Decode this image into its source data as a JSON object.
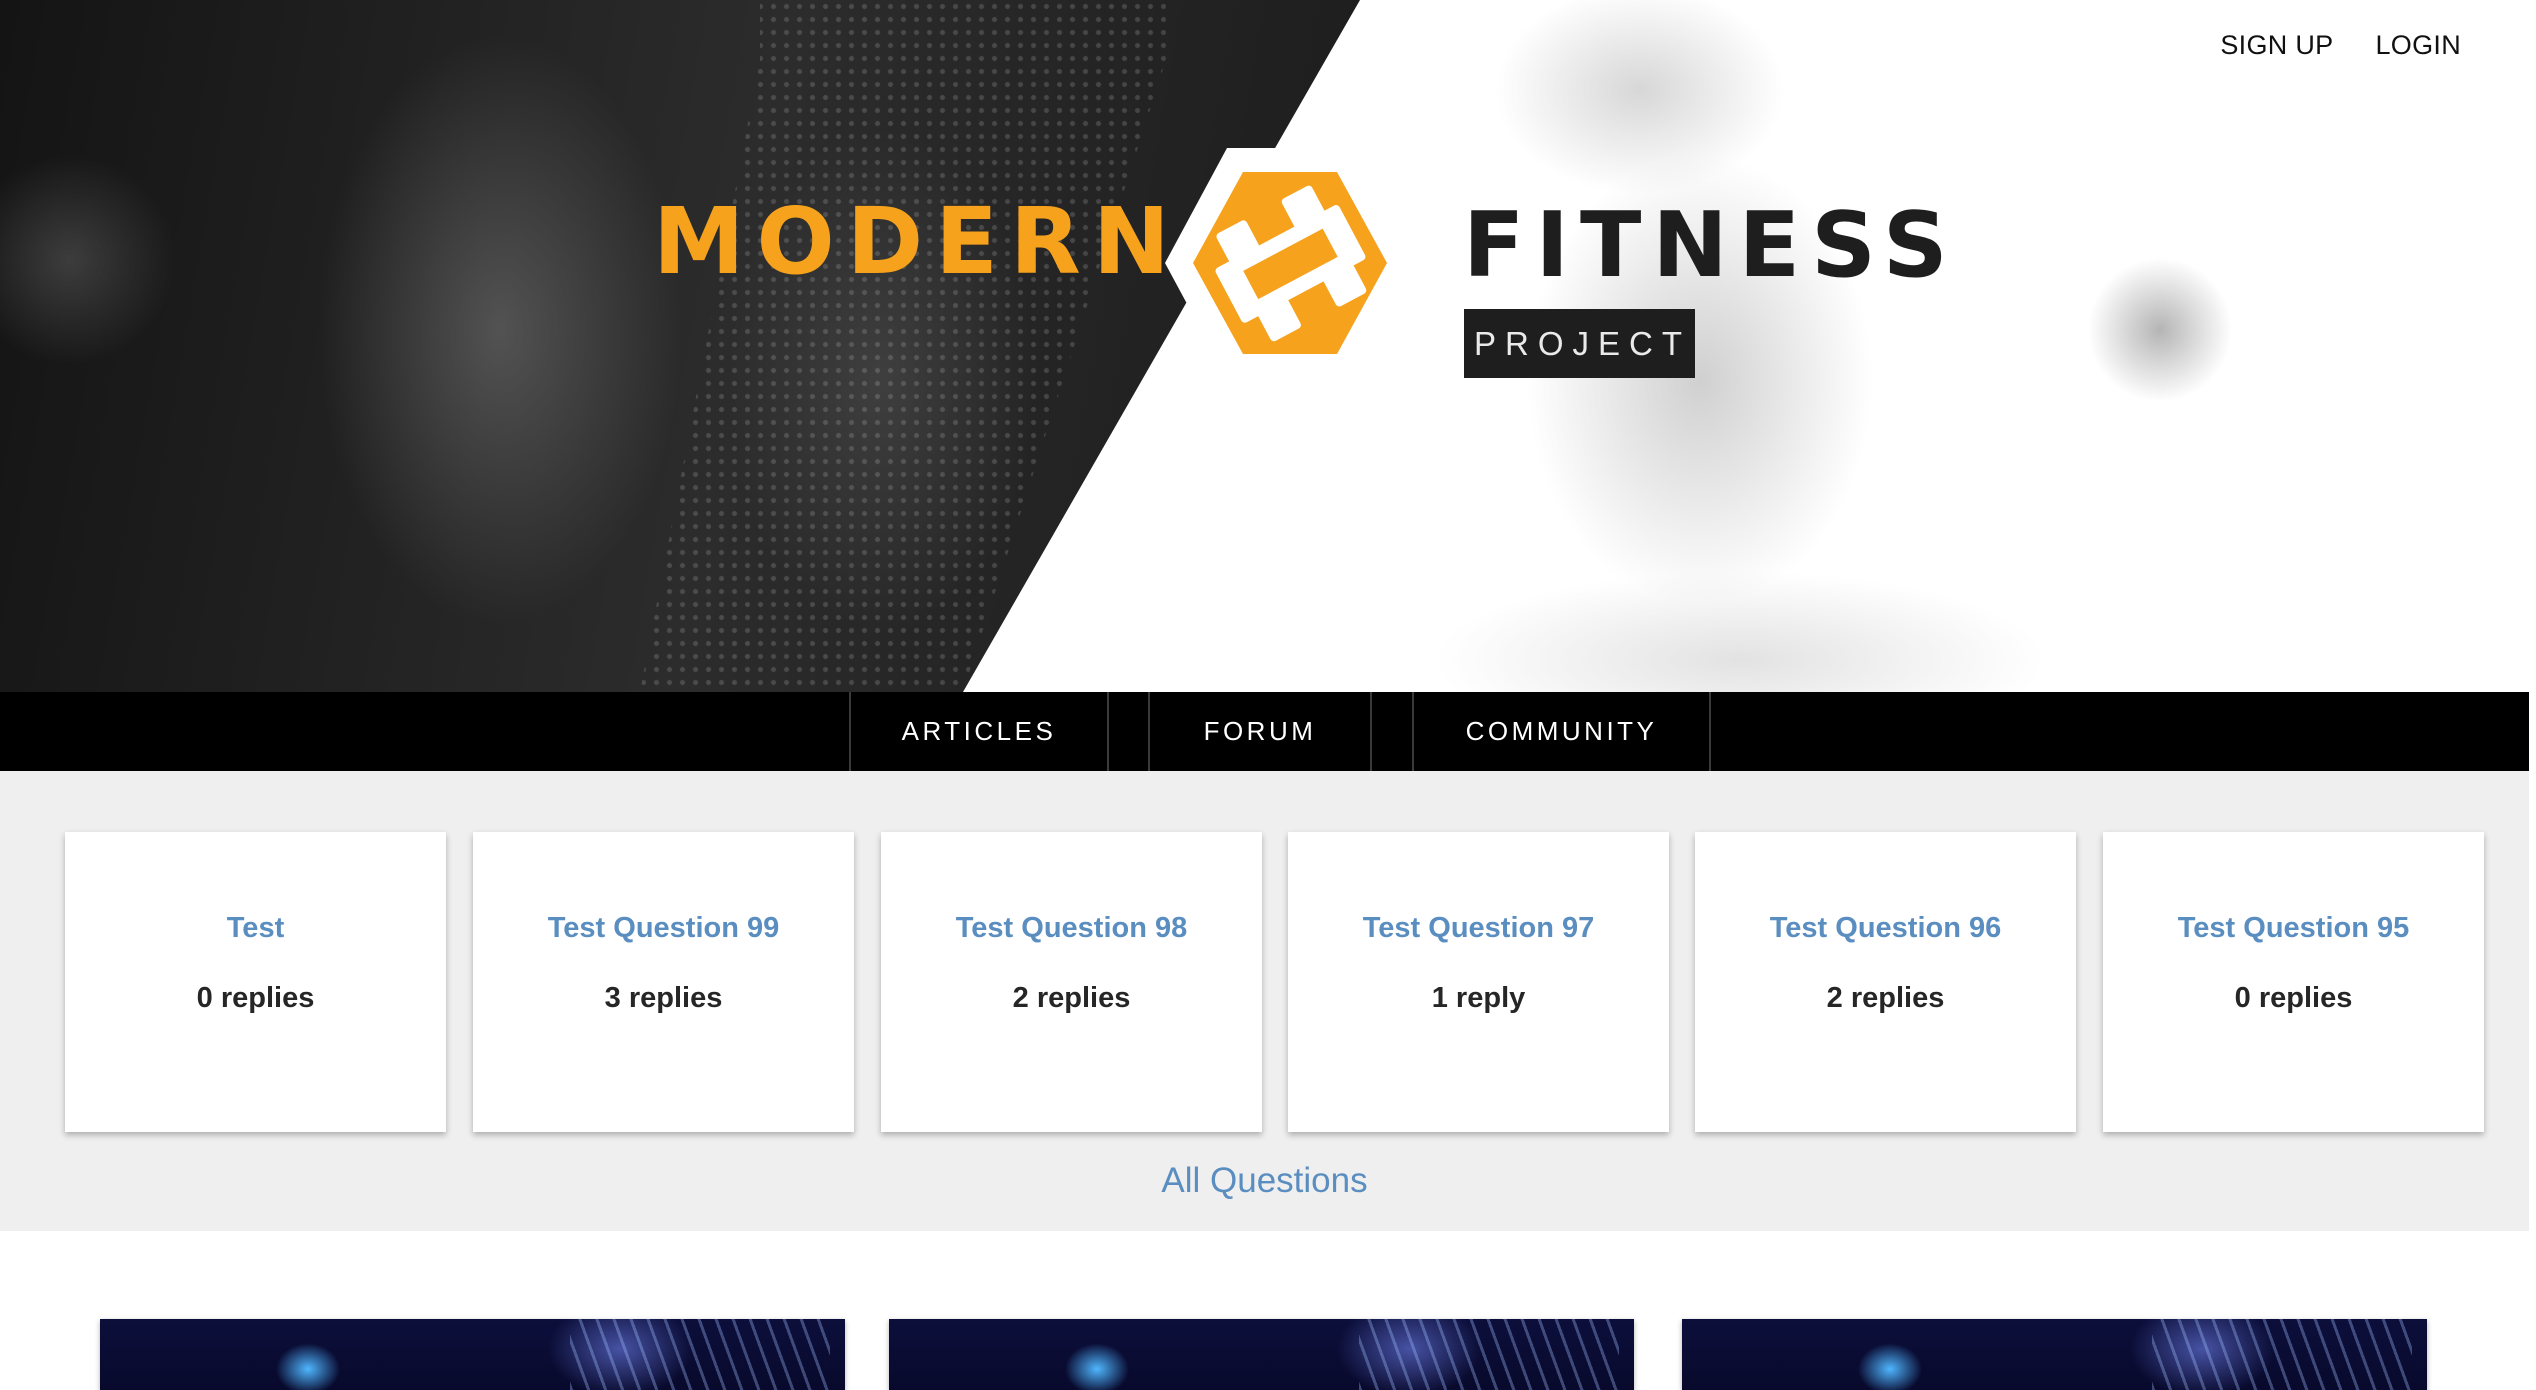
{
  "header": {
    "auth_links": [
      {
        "label": "SIGN UP"
      },
      {
        "label": "LOGIN"
      }
    ],
    "logo": {
      "word_left": "MODERN",
      "word_right": "FITNESS",
      "tag": "PROJECT"
    }
  },
  "nav": {
    "items": [
      {
        "label": "ARTICLES"
      },
      {
        "label": "FORUM"
      },
      {
        "label": "COMMUNITY"
      }
    ]
  },
  "questions": {
    "cards": [
      {
        "title": "Test",
        "replies": "0 replies"
      },
      {
        "title": "Test Question 99",
        "replies": "3 replies"
      },
      {
        "title": "Test Question 98",
        "replies": "2 replies"
      },
      {
        "title": "Test Question 97",
        "replies": "1 reply"
      },
      {
        "title": "Test Question 96",
        "replies": "2 replies"
      },
      {
        "title": "Test Question 95",
        "replies": "0 replies"
      }
    ],
    "all_link": "All Questions"
  },
  "colors": {
    "brand_orange": "#f6a21c",
    "link_blue": "#5b8ec0",
    "nav_bg": "#000000",
    "section_bg": "#efefef"
  }
}
